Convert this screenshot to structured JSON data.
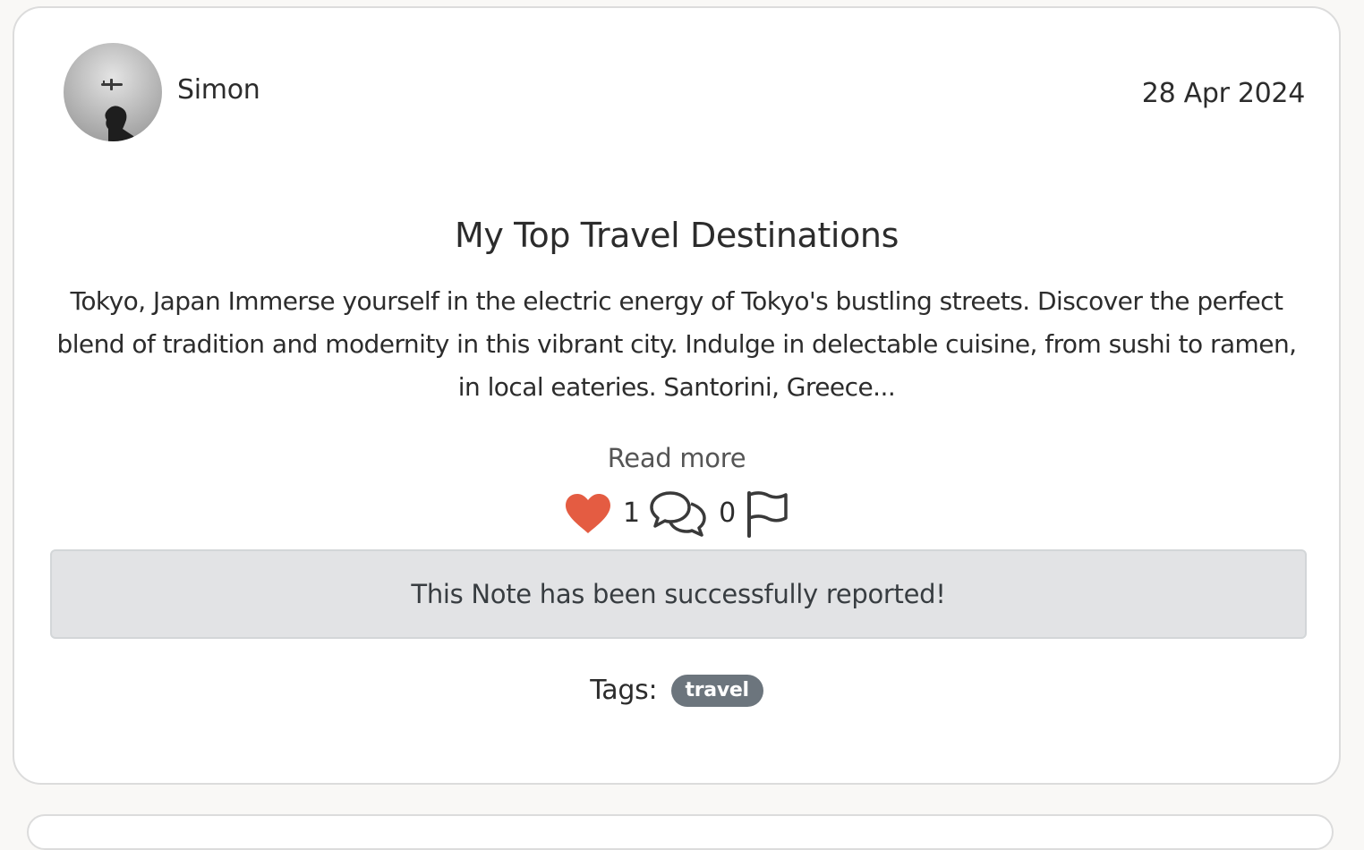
{
  "post": {
    "author": "Simon",
    "date": "28 Apr 2024",
    "title": "My Top Travel Destinations",
    "excerpt": "Tokyo, Japan Immerse yourself in the electric energy of Tokyo's bustling streets. Discover the perfect blend of tradition and modernity in this vibrant city. Indulge in delectable cuisine, from sushi to ramen, in local eateries. Santorini, Greece...",
    "read_more_label": "Read more",
    "likes_count": "1",
    "comments_count": "0",
    "like_icon": "heart-icon",
    "comment_icon": "comments-icon",
    "report_icon": "flag-icon",
    "report_alert": "This Note has been successfully reported!",
    "tags_label": "Tags:",
    "tags": [
      "travel"
    ]
  },
  "colors": {
    "page_background": "#f9f8f6",
    "card_background": "#ffffff",
    "heart": "#e45c42",
    "alert_background": "#e2e3e5",
    "tag_background": "#6c757d"
  }
}
